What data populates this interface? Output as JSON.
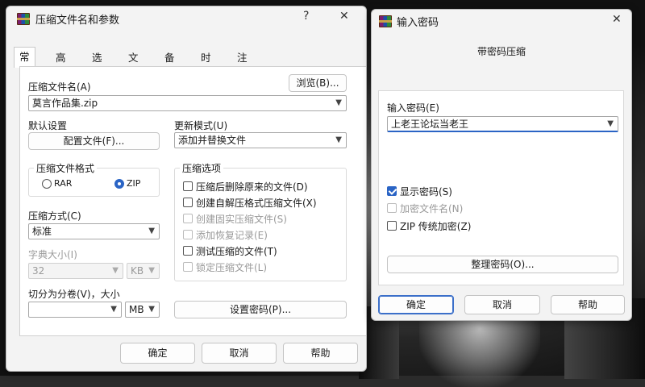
{
  "main_dialog": {
    "title": "压缩文件名和参数",
    "help_glyph": "?",
    "close_glyph": "✕",
    "tabs": [
      "常规",
      "高级",
      "选项",
      "文件",
      "备份",
      "时间",
      "注释"
    ],
    "archive_name_label": "压缩文件名(A)",
    "archive_name_value": "莫言作品集.zip",
    "browse_button": "浏览(B)...",
    "default_settings_label": "默认设置",
    "profiles_button": "配置文件(F)...",
    "update_mode_label": "更新模式(U)",
    "update_mode_value": "添加并替换文件",
    "format_group_title": "压缩文件格式",
    "format_rar": "RAR",
    "format_zip": "ZIP",
    "method_label": "压缩方式(C)",
    "method_value": "标准",
    "dict_label": "字典大小(I)",
    "dict_value": "32",
    "dict_unit": "KB",
    "split_label": "切分为分卷(V)，大小",
    "split_value": "",
    "split_unit": "MB",
    "options_group_title": "压缩选项",
    "options": [
      {
        "label": "压缩后删除原来的文件(D)",
        "checked": false,
        "enabled": true
      },
      {
        "label": "创建自解压格式压缩文件(X)",
        "checked": false,
        "enabled": true
      },
      {
        "label": "创建固实压缩文件(S)",
        "checked": false,
        "enabled": false
      },
      {
        "label": "添加恢复记录(E)",
        "checked": false,
        "enabled": false
      },
      {
        "label": "测试压缩的文件(T)",
        "checked": false,
        "enabled": true
      },
      {
        "label": "锁定压缩文件(L)",
        "checked": false,
        "enabled": false
      }
    ],
    "set_password_button": "设置密码(P)...",
    "ok_button": "确定",
    "cancel_button": "取消",
    "help_button": "帮助"
  },
  "password_dialog": {
    "title": "输入密码",
    "close_glyph": "✕",
    "subtitle": "带密码压缩",
    "password_label": "输入密码(E)",
    "password_value": "上老王论坛当老王",
    "show_password": {
      "label": "显示密码(S)",
      "checked": true
    },
    "encrypt_names": {
      "label": "加密文件名(N)",
      "checked": false,
      "enabled": false
    },
    "zip_legacy": {
      "label": "ZIP 传统加密(Z)",
      "checked": false
    },
    "organize_button": "整理密码(O)...",
    "ok_button": "确定",
    "cancel_button": "取消",
    "help_button": "帮助"
  },
  "colors": {
    "accent": "#2a64c5",
    "window_bg": "#f3f3f3"
  }
}
